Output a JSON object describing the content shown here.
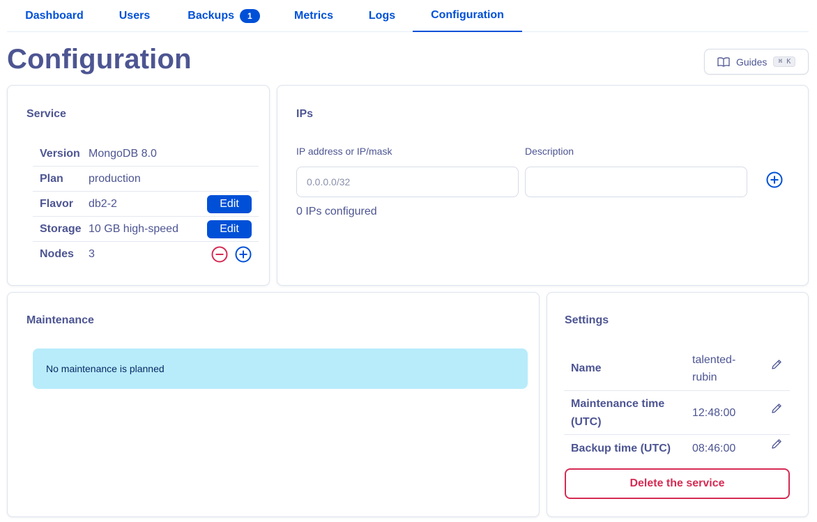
{
  "tabs": [
    {
      "label": "Dashboard"
    },
    {
      "label": "Users"
    },
    {
      "label": "Backups",
      "badge": "1"
    },
    {
      "label": "Metrics"
    },
    {
      "label": "Logs"
    },
    {
      "label": "Configuration",
      "active": true
    }
  ],
  "header": {
    "title": "Configuration",
    "guides_label": "Guides",
    "guides_shortcut": "⌘ K"
  },
  "service": {
    "title": "Service",
    "rows": [
      {
        "label": "Version",
        "value": "MongoDB 8.0"
      },
      {
        "label": "Plan",
        "value": "production"
      },
      {
        "label": "Flavor",
        "value": "db2-2",
        "action": "Edit"
      },
      {
        "label": "Storage",
        "value": "10 GB high-speed",
        "action": "Edit"
      },
      {
        "label": "Nodes",
        "value": "3"
      }
    ]
  },
  "ips": {
    "title": "IPs",
    "ip_label": "IP address or IP/mask",
    "ip_placeholder": "0.0.0.0/32",
    "desc_label": "Description",
    "desc_value": "",
    "count_text": "0 IPs configured"
  },
  "maintenance": {
    "title": "Maintenance",
    "message": "No maintenance is planned"
  },
  "settings": {
    "title": "Settings",
    "name_label": "Name",
    "name_value_line1": "talented-",
    "name_value_line2": "rubin",
    "maint_label_line1": "Maintenance time",
    "maint_label_line2": "(UTC)",
    "maint_value": "12:48:00",
    "backup_label": "Backup time (UTC)",
    "backup_value": "08:46:00",
    "delete_label": "Delete the service"
  },
  "colors": {
    "primary": "#0050d7",
    "text": "#4d5592",
    "danger": "#d52b54",
    "info_bg": "#b8ecfb"
  }
}
